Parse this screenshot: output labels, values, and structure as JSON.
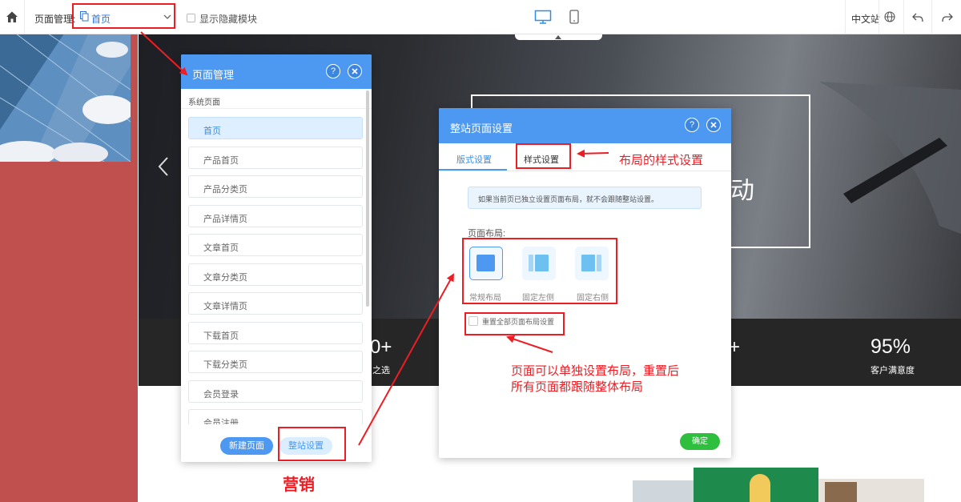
{
  "topbar": {
    "page_manage_label": "页面管理:",
    "current_page": "首页",
    "show_hidden_label": "显示隐藏模块",
    "language": "中文站"
  },
  "hero": {
    "partial_text": "动",
    "stats": [
      {
        "value": "0+",
        "label": "之选"
      },
      {
        "value": "+",
        "label": ""
      },
      {
        "value": "95%",
        "label": "客户满意度"
      }
    ]
  },
  "page_panel": {
    "title": "页面管理",
    "section_label": "系统页面",
    "items": [
      "首页",
      "产品首页",
      "产品分类页",
      "产品详情页",
      "文章首页",
      "文章分类页",
      "文章详情页",
      "下载首页",
      "下载分类页",
      "会员登录",
      "会员注册"
    ],
    "new_page_button": "新建页面",
    "site_settings_button": "整站设置"
  },
  "site_panel": {
    "title": "整站页面设置",
    "tabs": [
      "版式设置",
      "样式设置"
    ],
    "notice": "如果当前页已独立设置页面布局，就不会跟随整站设置。",
    "layout_label": "页面布局:",
    "layouts": [
      "常规布局",
      "固定左侧",
      "固定右侧"
    ],
    "reset_label": "重置全部页面布局设置",
    "confirm_button": "确定"
  },
  "annotations": {
    "style_note": "布局的样式设置",
    "layout_note_line1": "页面可以单独设置布局，重置后",
    "layout_note_line2": "所有页面都跟随整体布局",
    "marketing": "营销"
  },
  "colors": {
    "primary_blue": "#4d98f0",
    "confirm_green": "#2fbf3f",
    "annotation_red": "#ee1d23"
  }
}
